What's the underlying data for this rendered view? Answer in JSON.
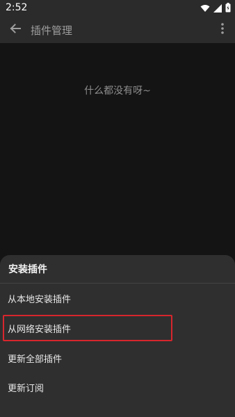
{
  "status_bar": {
    "time": "2:52",
    "icons": [
      "wifi-icon",
      "cellular-signal-icon",
      "battery-icon"
    ]
  },
  "app_bar": {
    "back_icon": "arrow-left-icon",
    "title": "插件管理",
    "more_icon": "more-vertical-icon"
  },
  "content": {
    "empty_message": "什么都没有呀~"
  },
  "bottom_sheet": {
    "title": "安装插件",
    "items": [
      {
        "label": "从本地安装插件"
      },
      {
        "label": "从网络安装插件"
      },
      {
        "label": "更新全部插件"
      },
      {
        "label": "更新订阅"
      }
    ]
  },
  "colors": {
    "background": "#141414",
    "app_bar": "#2b2b2b",
    "sheet": "#2f2f2f",
    "highlight": "#d8262d"
  }
}
